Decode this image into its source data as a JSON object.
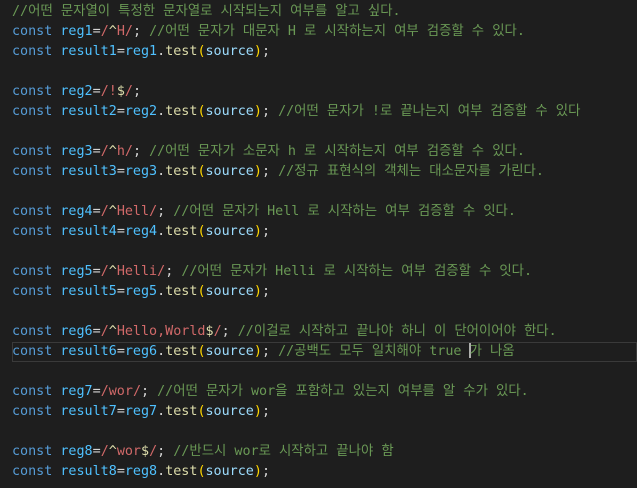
{
  "editor": {
    "line1": {
      "comment": "//어떤 문자열이 특정한 문자열로 시작되는지 여부를 알고 싶다."
    },
    "line2": {
      "kw": "const",
      "var": "reg1",
      "eq": "=",
      "rx_open": "/",
      "rx_anchor": "^",
      "rx_body": "H",
      "rx_close": "/",
      "semi": ";",
      "comment": "//어떤 문자가 대문자 H 로 시작하는지 여부 검증할 수 있다."
    },
    "line3": {
      "kw": "const",
      "var": "result1",
      "eq": "=",
      "obj": "reg1",
      "dot": ".",
      "fn": "test",
      "paren_open": "(",
      "arg": "source",
      "paren_close": ")",
      "semi": ";"
    },
    "line5": {
      "kw": "const",
      "var": "reg2",
      "eq": "=",
      "rx_open": "/",
      "rx_body": "!",
      "rx_dollar": "$",
      "rx_close": "/",
      "semi": ";"
    },
    "line6": {
      "kw": "const",
      "var": "result2",
      "eq": "=",
      "obj": "reg2",
      "dot": ".",
      "fn": "test",
      "paren_open": "(",
      "arg": "source",
      "paren_close": ")",
      "semi": ";",
      "comment": "//어떤 문자가 !로 끝나는지 여부 검증할 수 있다"
    },
    "line8": {
      "kw": "const",
      "var": "reg3",
      "eq": "=",
      "rx_open": "/",
      "rx_anchor": "^",
      "rx_body": "h",
      "rx_close": "/",
      "semi": ";",
      "comment": "//어떤 문자가 소문자 h 로 시작하는지 여부 검증할 수 있다."
    },
    "line9": {
      "kw": "const",
      "var": "result3",
      "eq": "=",
      "obj": "reg3",
      "dot": ".",
      "fn": "test",
      "paren_open": "(",
      "arg": "source",
      "paren_close": ")",
      "semi": ";",
      "comment": "//정규 표현식의 객체는 대소문자를 가린다."
    },
    "line11": {
      "kw": "const",
      "var": "reg4",
      "eq": "=",
      "rx_open": "/",
      "rx_anchor": "^",
      "rx_body": "Hell",
      "rx_close": "/",
      "semi": ";",
      "comment": "//어떤 문자가 Hell 로 시작하는 여부 검증할 수 잇다."
    },
    "line12": {
      "kw": "const",
      "var": "result4",
      "eq": "=",
      "obj": "reg4",
      "dot": ".",
      "fn": "test",
      "paren_open": "(",
      "arg": "source",
      "paren_close": ")",
      "semi": ";"
    },
    "line14": {
      "kw": "const",
      "var": "reg5",
      "eq": "=",
      "rx_open": "/",
      "rx_anchor": "^",
      "rx_body": "Helli",
      "rx_close": "/",
      "semi": ";",
      "comment": "//어떤 문자가 Helli 로 시작하는 여부 검증할 수 잇다."
    },
    "line15": {
      "kw": "const",
      "var": "result5",
      "eq": "=",
      "obj": "reg5",
      "dot": ".",
      "fn": "test",
      "paren_open": "(",
      "arg": "source",
      "paren_close": ")",
      "semi": ";"
    },
    "line17": {
      "kw": "const",
      "var": "reg6",
      "eq": "=",
      "rx_open": "/",
      "rx_anchor": "^",
      "rx_body": "Hello,World",
      "rx_dollar": "$",
      "rx_close": "/",
      "semi": ";",
      "comment": "//이걸로 시작하고 끝나야 하니 이 단어이어야 한다."
    },
    "line18": {
      "kw": "const",
      "var": "result6",
      "eq": "=",
      "obj": "reg6",
      "dot": ".",
      "fn": "test",
      "paren_open": "(",
      "arg": "source",
      "paren_close": ")",
      "semi": ";",
      "comment_a": "//공백도 모두 일치해야 true ",
      "comment_b": "가 나옴"
    },
    "line20": {
      "kw": "const",
      "var": "reg7",
      "eq": "=",
      "rx_open": "/",
      "rx_body": "wor",
      "rx_close": "/",
      "semi": ";",
      "comment": "//어떤 문자가 wor을 포함하고 있는지 여부를 알 수가 있다."
    },
    "line21": {
      "kw": "const",
      "var": "result7",
      "eq": "=",
      "obj": "reg7",
      "dot": ".",
      "fn": "test",
      "paren_open": "(",
      "arg": "source",
      "paren_close": ")",
      "semi": ";"
    },
    "line23": {
      "kw": "const",
      "var": "reg8",
      "eq": "=",
      "rx_open": "/",
      "rx_anchor": "^",
      "rx_body": "wor",
      "rx_dollar": "$",
      "rx_close": "/",
      "semi": ";",
      "comment": "//반드시 wor로 시작하고 끝나야 함"
    },
    "line24": {
      "kw": "const",
      "var": "result8",
      "eq": "=",
      "obj": "reg8",
      "dot": ".",
      "fn": "test",
      "paren_open": "(",
      "arg": "source",
      "paren_close": ")",
      "semi": ";"
    }
  }
}
